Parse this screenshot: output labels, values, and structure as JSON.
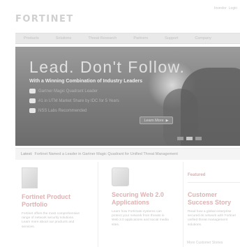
{
  "top_links": [
    "Investor",
    "Login"
  ],
  "logo": {
    "text": "FORTINET"
  },
  "nav": {
    "items": [
      "Products",
      "Solutions",
      "Threat Research",
      "Partners",
      "Support",
      "Company"
    ]
  },
  "hero": {
    "title": "Lead. Don't Follow.",
    "subtitle": "With a Winning Combination of Industry Leaders",
    "bullets": [
      "Gartner Magic Quadrant Leader",
      "#1 in UTM Market Share by IDC for 5 Years",
      "NSS Labs Recommended"
    ],
    "button_label": "Learn More",
    "slide_count": 3,
    "active_slide": 1
  },
  "strip": {
    "label": "Latest:",
    "text": "Fortinet Named a Leader in Gartner Magic Quadrant for Unified Threat Management"
  },
  "cards": [
    {
      "title": "Fortinet Product Portfolio",
      "body": "Fortinet offers the most comprehensive range of network security solutions. Learn more about our products and services."
    },
    {
      "title": "Securing Web 2.0 Applications",
      "body": "Learn how FortiGate systems can protect your network from threats in Web 2.0 applications and social media sites."
    }
  ],
  "sidebar": {
    "section_label": "Featured",
    "title": "Customer Success Story",
    "body": "Read how a global enterprise secured its network with Fortinet unified threat management solutions.",
    "footer_link": "More Customer Stories"
  },
  "colors": {
    "accent": "#ddb2b2",
    "hero_bg": "#8a8a8a",
    "nav_bg": "#e9e9e9"
  }
}
